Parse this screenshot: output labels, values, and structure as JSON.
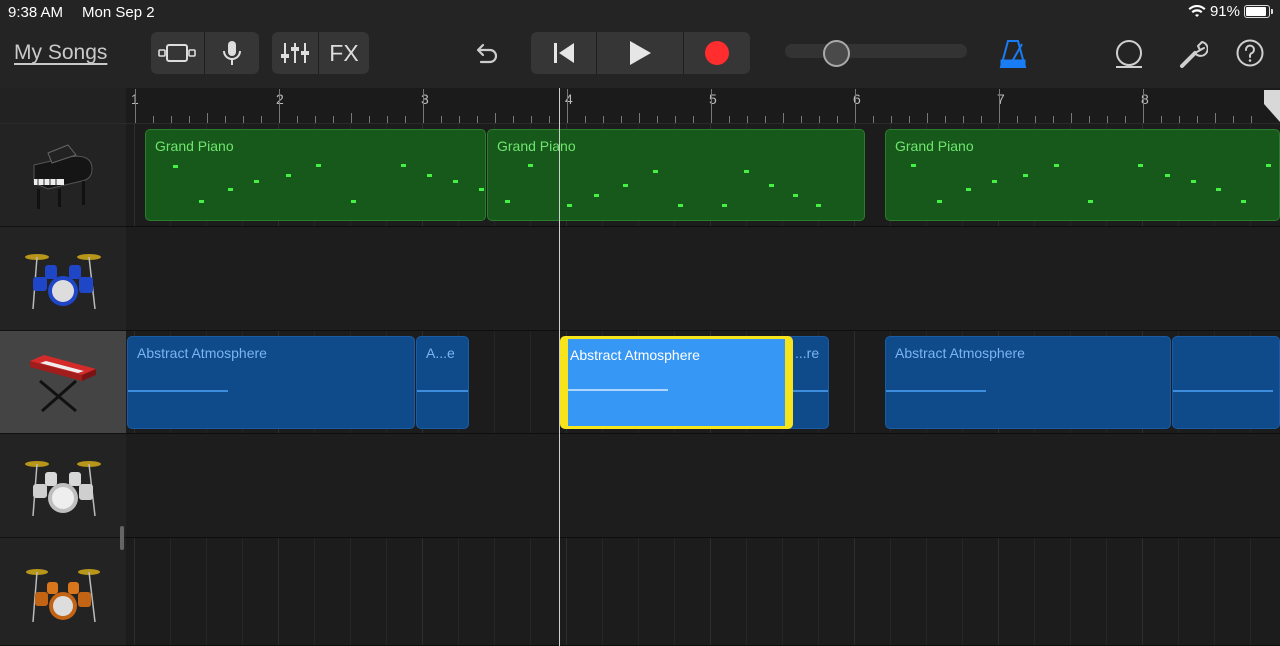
{
  "status": {
    "time": "9:38 AM",
    "date": "Mon Sep 2",
    "battery": "91%",
    "battery_level": 0.91
  },
  "toolbar": {
    "my_songs": "My Songs",
    "fx": "FX",
    "icons": [
      "browser-view-icon",
      "microphone-icon",
      "mixer-icon",
      "undo-icon",
      "go-to-start-icon",
      "play-icon",
      "record-icon",
      "metronome-icon",
      "loop-browser-icon",
      "settings-wrench-icon",
      "help-icon"
    ],
    "record_color": "#ff2d2d",
    "metronome_color": "#1a7cf5",
    "volume_level": 0.25
  },
  "ruler": {
    "bars": [
      "1",
      "2",
      "3",
      "4",
      "5",
      "6",
      "7",
      "8"
    ]
  },
  "tracks": [
    {
      "instrument": "Grand Piano",
      "icon": "grand-piano-icon",
      "regions": [
        {
          "name": "Grand Piano",
          "type": "midi"
        },
        {
          "name": "Grand Piano",
          "type": "midi"
        },
        {
          "name": "Grand Piano",
          "type": "midi"
        }
      ]
    },
    {
      "instrument": "Drums",
      "icon": "blue-drum-kit-icon",
      "regions": []
    },
    {
      "instrument": "Keyboard",
      "icon": "red-keyboard-icon",
      "selected": true,
      "regions": [
        {
          "name": "Abstract Atmosphere",
          "type": "audio"
        },
        {
          "name": "A...e",
          "type": "audio"
        },
        {
          "name": "Abstract Atmosphere",
          "type": "audio",
          "selected": true
        },
        {
          "name": "...re",
          "type": "audio"
        },
        {
          "name": "Abstract Atmosphere",
          "type": "audio"
        },
        {
          "name": "",
          "type": "audio"
        }
      ]
    },
    {
      "instrument": "Drums",
      "icon": "silver-drum-kit-icon",
      "regions": []
    },
    {
      "instrument": "Drums",
      "icon": "orange-drum-kit-icon",
      "regions": []
    }
  ],
  "colors": {
    "midi_region": "#17591b",
    "audio_region": "#0f4a8a",
    "selected_audio": "#3797f5",
    "selection_border": "#f7e41b"
  }
}
